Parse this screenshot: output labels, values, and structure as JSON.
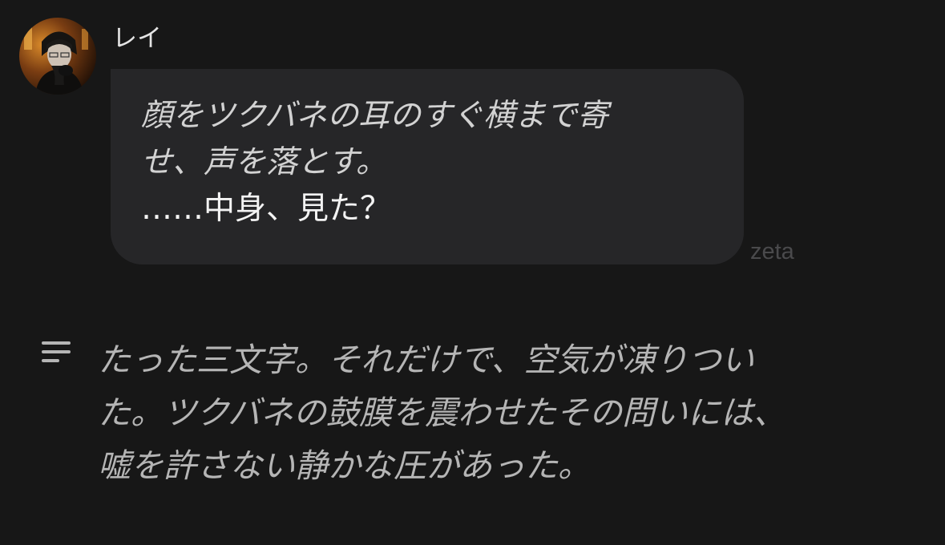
{
  "message": {
    "sender": "レイ",
    "avatar_icon": "character-avatar",
    "bubble_lines": [
      "顔をツクバネの耳のすぐ横まで寄",
      "せ、声を落とす。"
    ],
    "dialogue": "……中身、見た？",
    "watermark": "zeta"
  },
  "response": {
    "icon": "text-lines-icon",
    "lines": [
      "たった三文字。それだけで、空気が凍りつい",
      "た。ツクバネの鼓膜を震わせたその問いには、",
      "嘘を許さない静かな圧があった。"
    ]
  },
  "colors": {
    "background": "#171717",
    "bubble": "#262628",
    "narration_text": "#d2d2d2",
    "dialogue_text": "#f3f3f3",
    "body_text": "#b5b5b5",
    "watermark": "#4a4a4c"
  }
}
